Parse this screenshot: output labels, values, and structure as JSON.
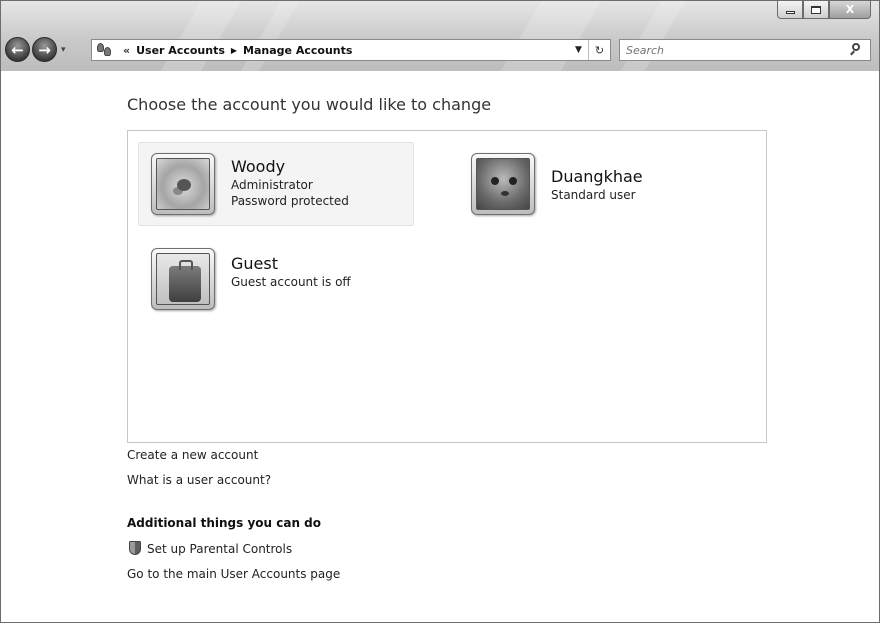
{
  "window": {
    "caption_min_icon": "minimize-icon",
    "caption_max_icon": "maximize-icon",
    "caption_close_glyph": "X"
  },
  "nav": {
    "back_glyph": "←",
    "forward_glyph": "→",
    "recent_glyph": "▾"
  },
  "address": {
    "overflow_glyph": "«",
    "crumbs": [
      "User Accounts",
      "Manage Accounts"
    ],
    "arrow_glyph": "▶",
    "dropdown_glyph": "▼",
    "refresh_glyph": "↻"
  },
  "search": {
    "placeholder": "Search"
  },
  "main": {
    "title": "Choose the account you would like to change",
    "accounts": [
      {
        "name": "Woody",
        "lines": [
          "Administrator",
          "Password protected"
        ],
        "picture": "fish-picture",
        "selected": true
      },
      {
        "name": "Duangkhae",
        "lines": [
          "Standard user"
        ],
        "picture": "kitten-picture",
        "selected": false
      },
      {
        "name": "Guest",
        "lines": [
          "Guest account is off"
        ],
        "picture": "suitcase-picture",
        "selected": false
      }
    ],
    "links": [
      "Create a new account",
      "What is a user account?"
    ],
    "additional_heading": "Additional things you can do",
    "additional_links": [
      "Set up Parental Controls",
      "Go to the main User Accounts page"
    ]
  }
}
